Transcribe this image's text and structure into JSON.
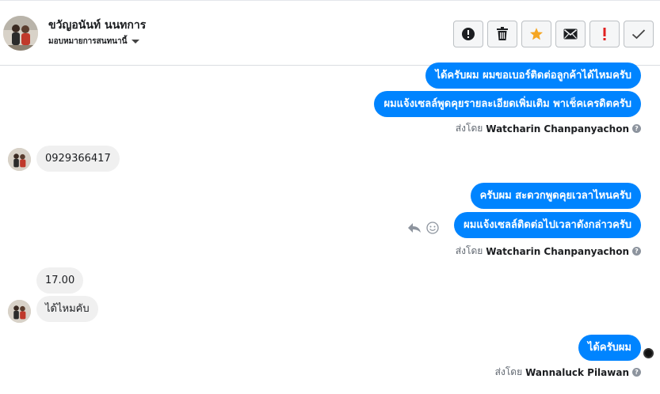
{
  "header": {
    "contact_name": "ขวัญอนันท์ นนทการ",
    "assign_label": "มอบหมายการสนทนานี้",
    "actions": [
      {
        "name": "report-spam-button",
        "icon": "alert-circle-icon"
      },
      {
        "name": "delete-button",
        "icon": "trash-icon"
      },
      {
        "name": "star-button",
        "icon": "star-icon",
        "color": "#f5a623"
      },
      {
        "name": "mark-unread-button",
        "icon": "envelope-icon"
      },
      {
        "name": "mark-important-button",
        "icon": "exclamation-icon",
        "color": "#e02020"
      },
      {
        "name": "mark-done-button",
        "icon": "check-icon"
      }
    ]
  },
  "messages": {
    "out_1": "ได้ครับผม ผมขอเบอร์ติดต่อลูกค้าได้ไหมครับ",
    "out_2": "ผมแจ้งเซลล์พูดคุยรายละเอียดเพิ่มเติม พาเช็คเครดิตครับ",
    "sent_by_label_1": "ส่งโดย",
    "sender_1": "Watcharin Chanpanyachon",
    "in_1": "0929366417",
    "out_3": "ครับผม สะดวกพูดคุยเวลาไหนครับ",
    "out_4": "ผมแจ้งเซลล์ติดต่อไปเวลาดังกล่าวครับ",
    "sent_by_label_2": "ส่งโดย",
    "sender_2": "Watcharin Chanpanyachon",
    "in_2": "17.00",
    "in_3": "ได้ไหมคับ",
    "out_5": "ได้ครับผม",
    "sent_by_label_3": "ส่งโดย",
    "sender_3": "Wannaluck Pilawan",
    "info_icon_glyph": "?"
  },
  "colors": {
    "outgoing_bubble": "#0084ff",
    "incoming_bubble": "#f0f0f0",
    "star": "#f5a623",
    "important": "#e02020"
  }
}
